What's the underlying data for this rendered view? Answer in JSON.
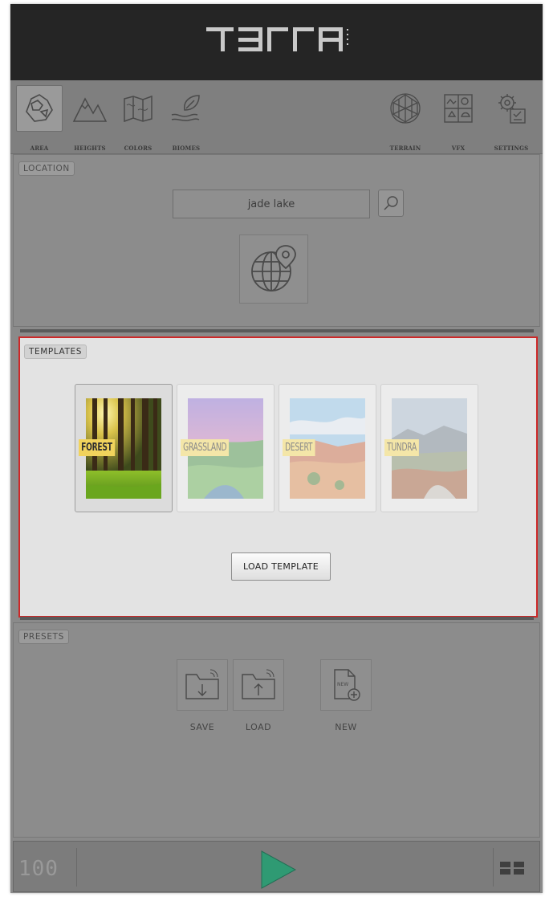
{
  "app": {
    "logo_text": "TERRA",
    "logo_subtext": "UNITY"
  },
  "toolbar": {
    "left_items": [
      {
        "label": "AREA",
        "icon": "area-icon",
        "active": true
      },
      {
        "label": "HEIGHTS",
        "icon": "mountains-icon",
        "active": false
      },
      {
        "label": "COLORS",
        "icon": "map-icon",
        "active": false
      },
      {
        "label": "BIOMES",
        "icon": "leaf-hand-icon",
        "active": false
      }
    ],
    "right_items": [
      {
        "label": "TERRAIN",
        "icon": "terrain-sphere-icon"
      },
      {
        "label": "VFX",
        "icon": "vfx-icon"
      },
      {
        "label": "SETTINGS",
        "icon": "settings-icon"
      }
    ]
  },
  "location": {
    "tag": "LOCATION",
    "search_value": "jade lake",
    "search_icon": "search-icon",
    "globe_icon": "globe-pin-icon"
  },
  "templates": {
    "tag": "TEMPLATES",
    "items": [
      {
        "label": "FOREST",
        "selected": true
      },
      {
        "label": "GRASSLAND",
        "selected": false
      },
      {
        "label": "DESERT",
        "selected": false
      },
      {
        "label": "TUNDRA",
        "selected": false
      }
    ],
    "load_button": "LOAD TEMPLATE"
  },
  "presets": {
    "tag": "PRESETS",
    "save_label": "SAVE",
    "load_label": "LOAD",
    "new_label": "NEW",
    "new_icon_text": "NEW"
  },
  "bottombar": {
    "counter": "100",
    "play_icon": "play-icon",
    "grid_icon": "grid-icon"
  },
  "colors": {
    "highlight_border": "#cc2828",
    "play_green": "#2f9a73",
    "ribbon_yellow": "#f1d35c"
  }
}
